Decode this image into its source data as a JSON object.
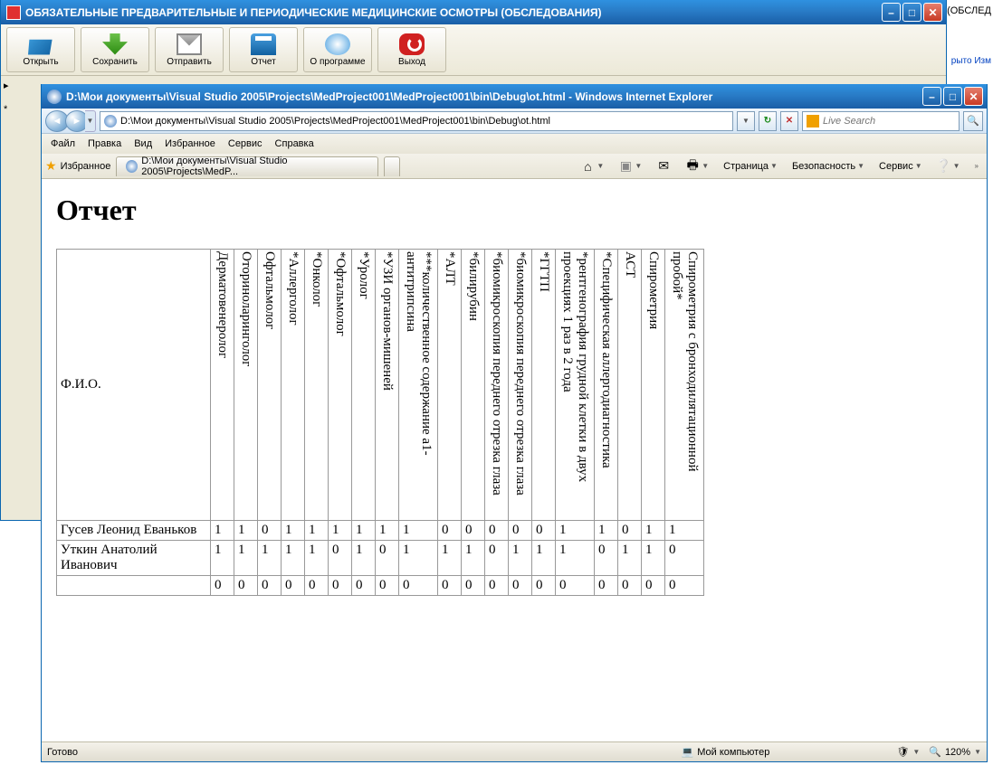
{
  "mainWindow": {
    "title": "ОБЯЗАТЕЛЬНЫЕ ПРЕДВАРИТЕЛЬНЫЕ И ПЕРИОДИЧЕСКИЕ МЕДИЦИНСКИЕ ОСМОТРЫ (ОБСЛЕДОВАНИЯ)",
    "toolbar": {
      "open": "Открыть",
      "save": "Сохранить",
      "send": "Отправить",
      "report": "Отчет",
      "about": "О программе",
      "exit": "Выход"
    },
    "leftMarks": {
      "arrow": "▸",
      "star": "*"
    }
  },
  "bgExtra": {
    "line1": "Ы (ОБСЛЕД",
    "line2": "рыто Изм"
  },
  "ie": {
    "title": "D:\\Мои документы\\Visual Studio 2005\\Projects\\MedProject001\\MedProject001\\bin\\Debug\\ot.html - Windows Internet Explorer",
    "address": "D:\\Мои документы\\Visual Studio 2005\\Projects\\MedProject001\\MedProject001\\bin\\Debug\\ot.html",
    "searchPlaceholder": "Live Search",
    "menu": {
      "file": "Файл",
      "edit": "Правка",
      "view": "Вид",
      "favorites": "Избранное",
      "service": "Сервис",
      "help": "Справка"
    },
    "favLabel": "Избранное",
    "tabTitle": "D:\\Мои документы\\Visual Studio 2005\\Projects\\MedP...",
    "cmdbar": {
      "page": "Страница",
      "safety": "Безопасность",
      "service": "Сервис"
    },
    "status": {
      "ready": "Готово",
      "zone": "Мой компьютер",
      "zoom": "120%"
    }
  },
  "report": {
    "heading": "Отчет",
    "fioHeader": "Ф.И.О.",
    "columns": [
      "Дерматовенеролог",
      "Оториноларинголог",
      "Офтальмолог",
      "*Аллерголог",
      "*Онколог",
      "*Офтальмолог",
      "*Уролог",
      "*УЗИ органов-мишеней",
      "***количественное содержание a1-антитрипсина",
      "*АЛТ",
      "*билирубин",
      "*биомикроскопия переднего отрезка глаза",
      "*биомикроскопия переднего отрезка глаза",
      "*ГГТП",
      "*рентгенография грудной клетки в двух проекциях 1 раз в 2 года",
      "*Специфическая аллергодиагностика",
      "АСТ",
      "Спирометрия",
      "Спирометрия с бронходилятационной пробой*"
    ],
    "rows": [
      {
        "name": "Гусев Леонид Еваньков",
        "vals": [
          1,
          1,
          0,
          1,
          1,
          1,
          1,
          1,
          1,
          0,
          0,
          0,
          0,
          0,
          1,
          1,
          0,
          1,
          1
        ]
      },
      {
        "name": "Уткин Анатолий Иванович",
        "vals": [
          1,
          1,
          1,
          1,
          1,
          0,
          1,
          0,
          1,
          1,
          1,
          0,
          1,
          1,
          1,
          0,
          1,
          1,
          0
        ]
      },
      {
        "name": "",
        "vals": [
          0,
          0,
          0,
          0,
          0,
          0,
          0,
          0,
          0,
          0,
          0,
          0,
          0,
          0,
          0,
          0,
          0,
          0,
          0
        ]
      }
    ]
  }
}
